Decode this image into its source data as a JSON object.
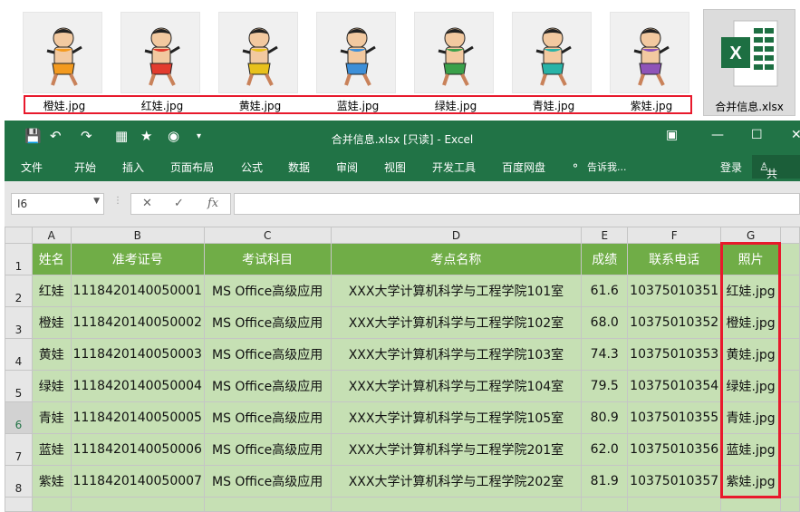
{
  "files": {
    "images": [
      {
        "name": "橙娃.jpg",
        "color": "#f39a1f"
      },
      {
        "name": "红娃.jpg",
        "color": "#e23b2e"
      },
      {
        "name": "黄娃.jpg",
        "color": "#e8c11c"
      },
      {
        "name": "蓝娃.jpg",
        "color": "#3d8fd8"
      },
      {
        "name": "绿娃.jpg",
        "color": "#3aa04a"
      },
      {
        "name": "青娃.jpg",
        "color": "#28b3a7"
      },
      {
        "name": "紫娃.jpg",
        "color": "#8e54b8"
      }
    ],
    "xlsx": {
      "name": "合并信息.xlsx",
      "letter": "X"
    }
  },
  "excel": {
    "title": "合并信息.xlsx  [只读] - Excel",
    "menu": [
      "文件",
      "开始",
      "插入",
      "页面布局",
      "公式",
      "数据",
      "审阅",
      "视图",
      "开发工具",
      "百度网盘",
      "告诉我..."
    ],
    "login": "登录",
    "share": "共享",
    "namebox": "I6",
    "fx": "fx",
    "columns": [
      "A",
      "B",
      "C",
      "D",
      "E",
      "F",
      "G"
    ],
    "rows": [
      "1",
      "2",
      "3",
      "4",
      "5",
      "6",
      "7",
      "8"
    ],
    "header": [
      "姓名",
      "准考证号",
      "考试科目",
      "考点名称",
      "成绩",
      "联系电话",
      "照片"
    ],
    "data": [
      [
        "红娃",
        "1118420140050001",
        "MS Office高级应用",
        "XXX大学计算机科学与工程学院101室",
        "61.6",
        "10375010351",
        "红娃.jpg"
      ],
      [
        "橙娃",
        "1118420140050002",
        "MS Office高级应用",
        "XXX大学计算机科学与工程学院102室",
        "68.0",
        "10375010352",
        "橙娃.jpg"
      ],
      [
        "黄娃",
        "1118420140050003",
        "MS Office高级应用",
        "XXX大学计算机科学与工程学院103室",
        "74.3",
        "10375010353",
        "黄娃.jpg"
      ],
      [
        "绿娃",
        "1118420140050004",
        "MS Office高级应用",
        "XXX大学计算机科学与工程学院104室",
        "79.5",
        "10375010354",
        "绿娃.jpg"
      ],
      [
        "青娃",
        "1118420140050005",
        "MS Office高级应用",
        "XXX大学计算机科学与工程学院105室",
        "80.9",
        "10375010355",
        "青娃.jpg"
      ],
      [
        "蓝娃",
        "1118420140050006",
        "MS Office高级应用",
        "XXX大学计算机科学与工程学院201室",
        "62.0",
        "10375010356",
        "蓝娃.jpg"
      ],
      [
        "紫娃",
        "1118420140050007",
        "MS Office高级应用",
        "XXX大学计算机科学与工程学院202室",
        "81.9",
        "10375010357",
        "紫娃.jpg"
      ]
    ]
  }
}
